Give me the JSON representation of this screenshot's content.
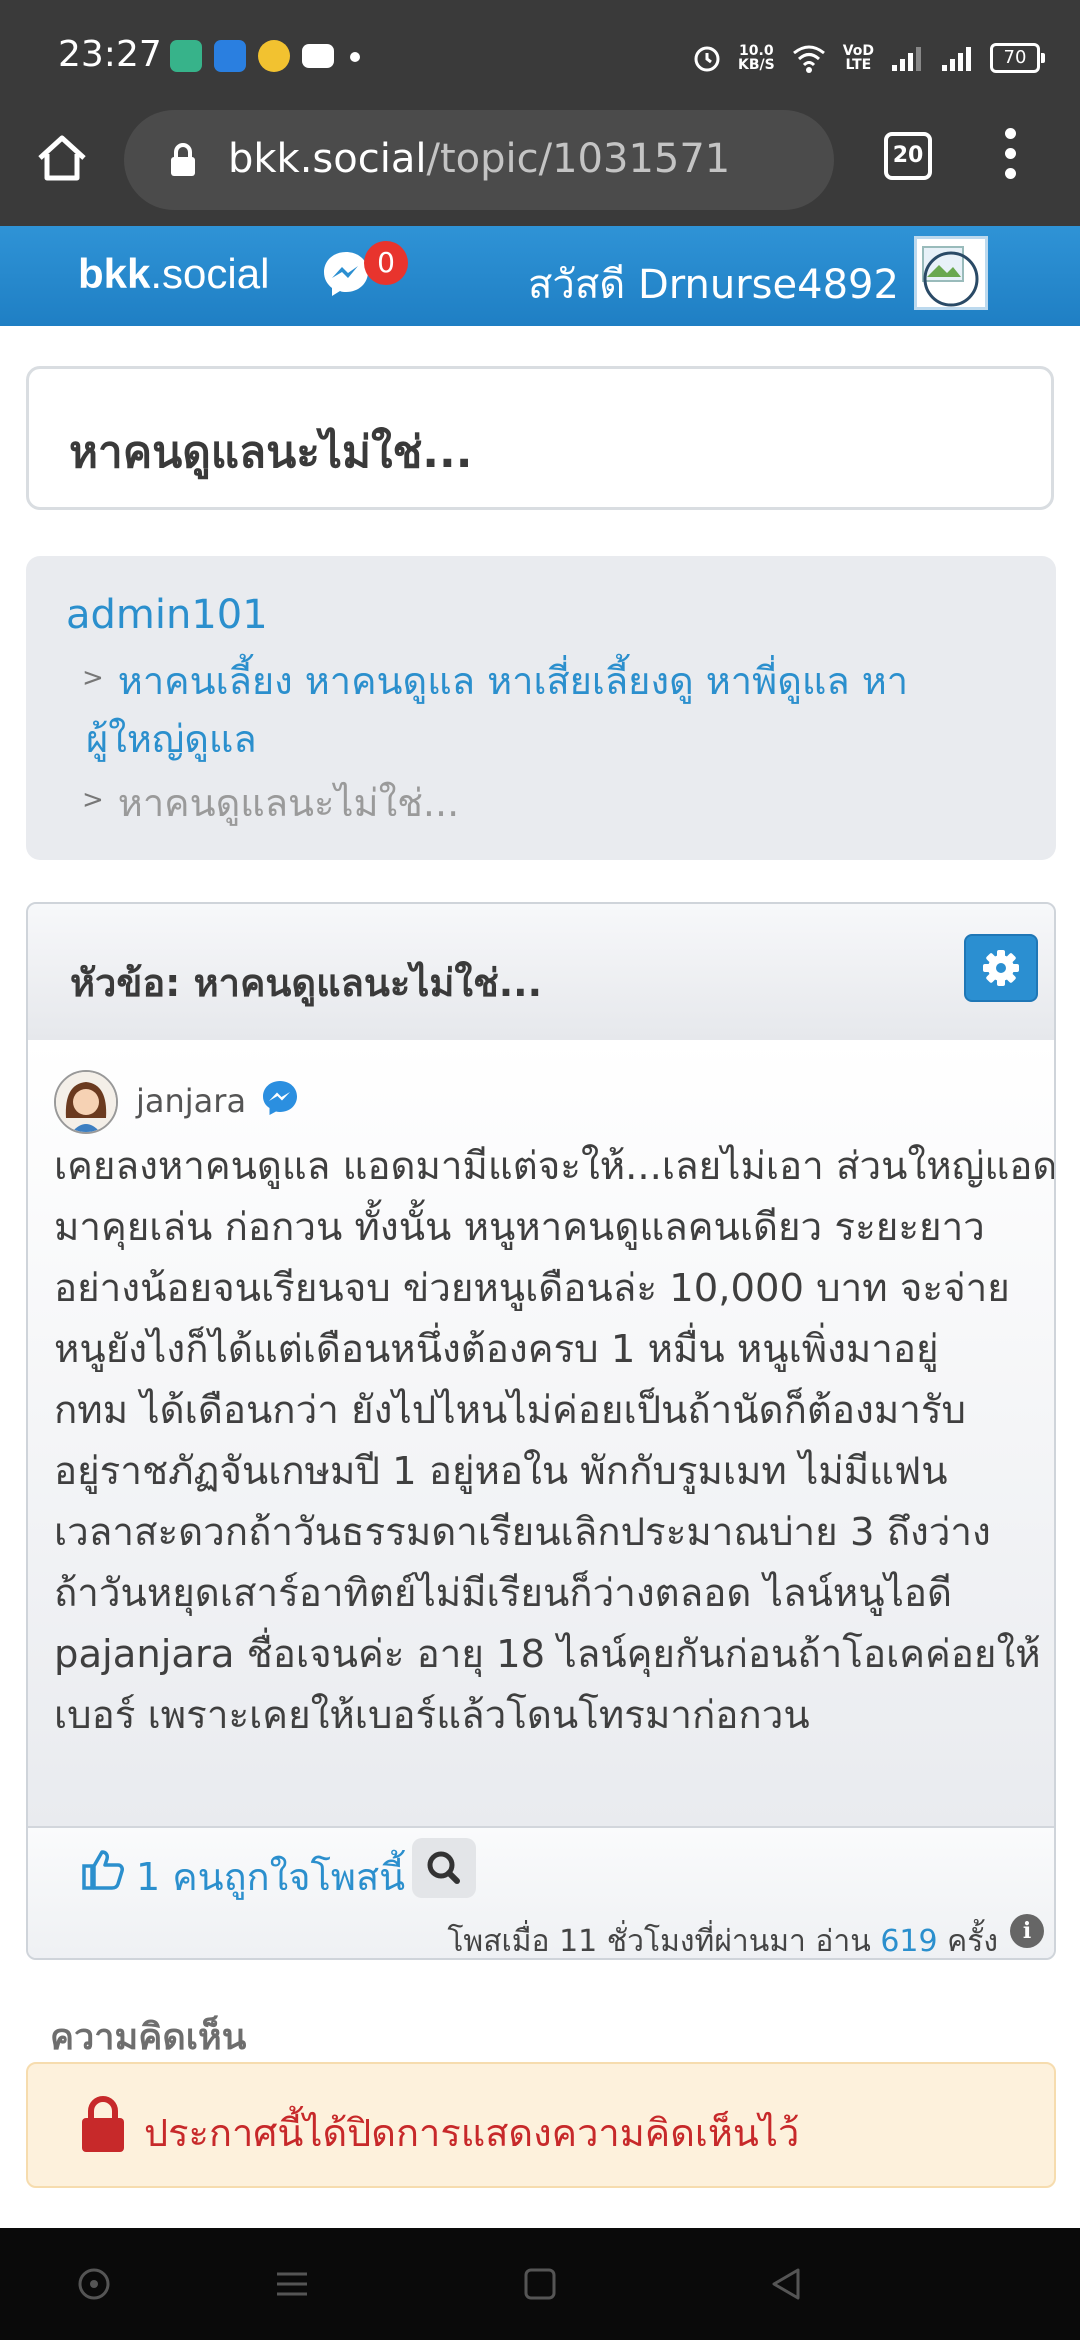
{
  "status_bar": {
    "time": "23:27",
    "speed_value": "10.0",
    "speed_unit": "KB/S",
    "volte_top": "VoD",
    "volte_bottom": "LTE",
    "battery": "70"
  },
  "browser": {
    "url_host": "bkk.social",
    "url_path": "/topic/1031571",
    "tab_count": "20"
  },
  "site": {
    "brand_bold": "bkk",
    "brand_rest": ".social",
    "message_count": "0",
    "greeting": "สวัสดี Drnurse4892"
  },
  "topic_title": "หาคนดูแลนะไม่ใช่...",
  "breadcrumb": {
    "user": "admin101",
    "category_line1": "หาคนเลี้ยง หาคนดูแล หาเสี่ยเลี้ยงดู หาพี่ดูแล หา",
    "category_line2": "ผู้ใหญ่ดูแล",
    "current": "หาคนดูแลนะไม่ใช่..."
  },
  "post": {
    "heading": "หัวข้อ: หาคนดูแลนะไม่ใช่...",
    "author": "janjara",
    "body_lines": [
      "เคยลงหาคนดูแล แอดมามีแต่จะให้...เลยไม่เอา ส่วนใหญ่แอด",
      "มาคุยเล่น ก่อกวน ทั้งนั้น หนูหาคนดูแลคนเดียว ระยะยาว",
      "อย่างน้อยจนเรียนจบ ข่วยหนูเดือนล่ะ 10,000 บาท จะจ่าย",
      "หนูยังไงก็ได้แต่เดือนหนึ่งต้องครบ 1 หมื่น หนูเพิ่งมาอยู่",
      "กทม ได้เดือนกว่า ยังไปไหนไม่ค่อยเป็นถ้านัดก็ต้องมารับ",
      "อยู่ราชภัฏจันเกษมปี 1 อยู่หอใน พักกับรูมเมท ไม่มีแฟน",
      "เวลาสะดวกถ้าวันธรรมดาเรียนเลิกประมาณบ่าย 3 ถึงว่าง",
      "ถ้าวันหยุดเสาร์อาทิตย์ไม่มีเรียนก็ว่างตลอด ไลน์หนูไอดี",
      "pajanjara ชื่อเจนค่ะ อายุ 18 ไลน์คุยกันก่อนถ้าโอเคค่อยให้",
      "เบอร์ เพราะเคยให้เบอร์แล้วโดนโทรมาก่อกวน"
    ],
    "likes_text": "1 คนถูกใจโพสนี้",
    "meta_prefix": "โพสเมื่อ 11 ชั่วโมงที่ผ่านมา อ่าน",
    "read_count": "619",
    "meta_suffix": "ครั้ง"
  },
  "comments": {
    "heading": "ความคิดเห็น",
    "closed_notice": "ประกาศนี้ได้ปิดการแสดงความคิดเห็นไว้"
  },
  "icons": {
    "home": "home-icon",
    "lock": "lock-icon",
    "messenger": "messenger-icon",
    "gear": "gear-icon",
    "like": "thumbs-up-icon",
    "search": "search-icon",
    "info": "info-icon"
  },
  "colors": {
    "brand_blue": "#2b8fcd",
    "header_gradient_top": "#2f93d6",
    "alert_red": "#c7292a",
    "alert_bg": "#fdf1dc"
  }
}
